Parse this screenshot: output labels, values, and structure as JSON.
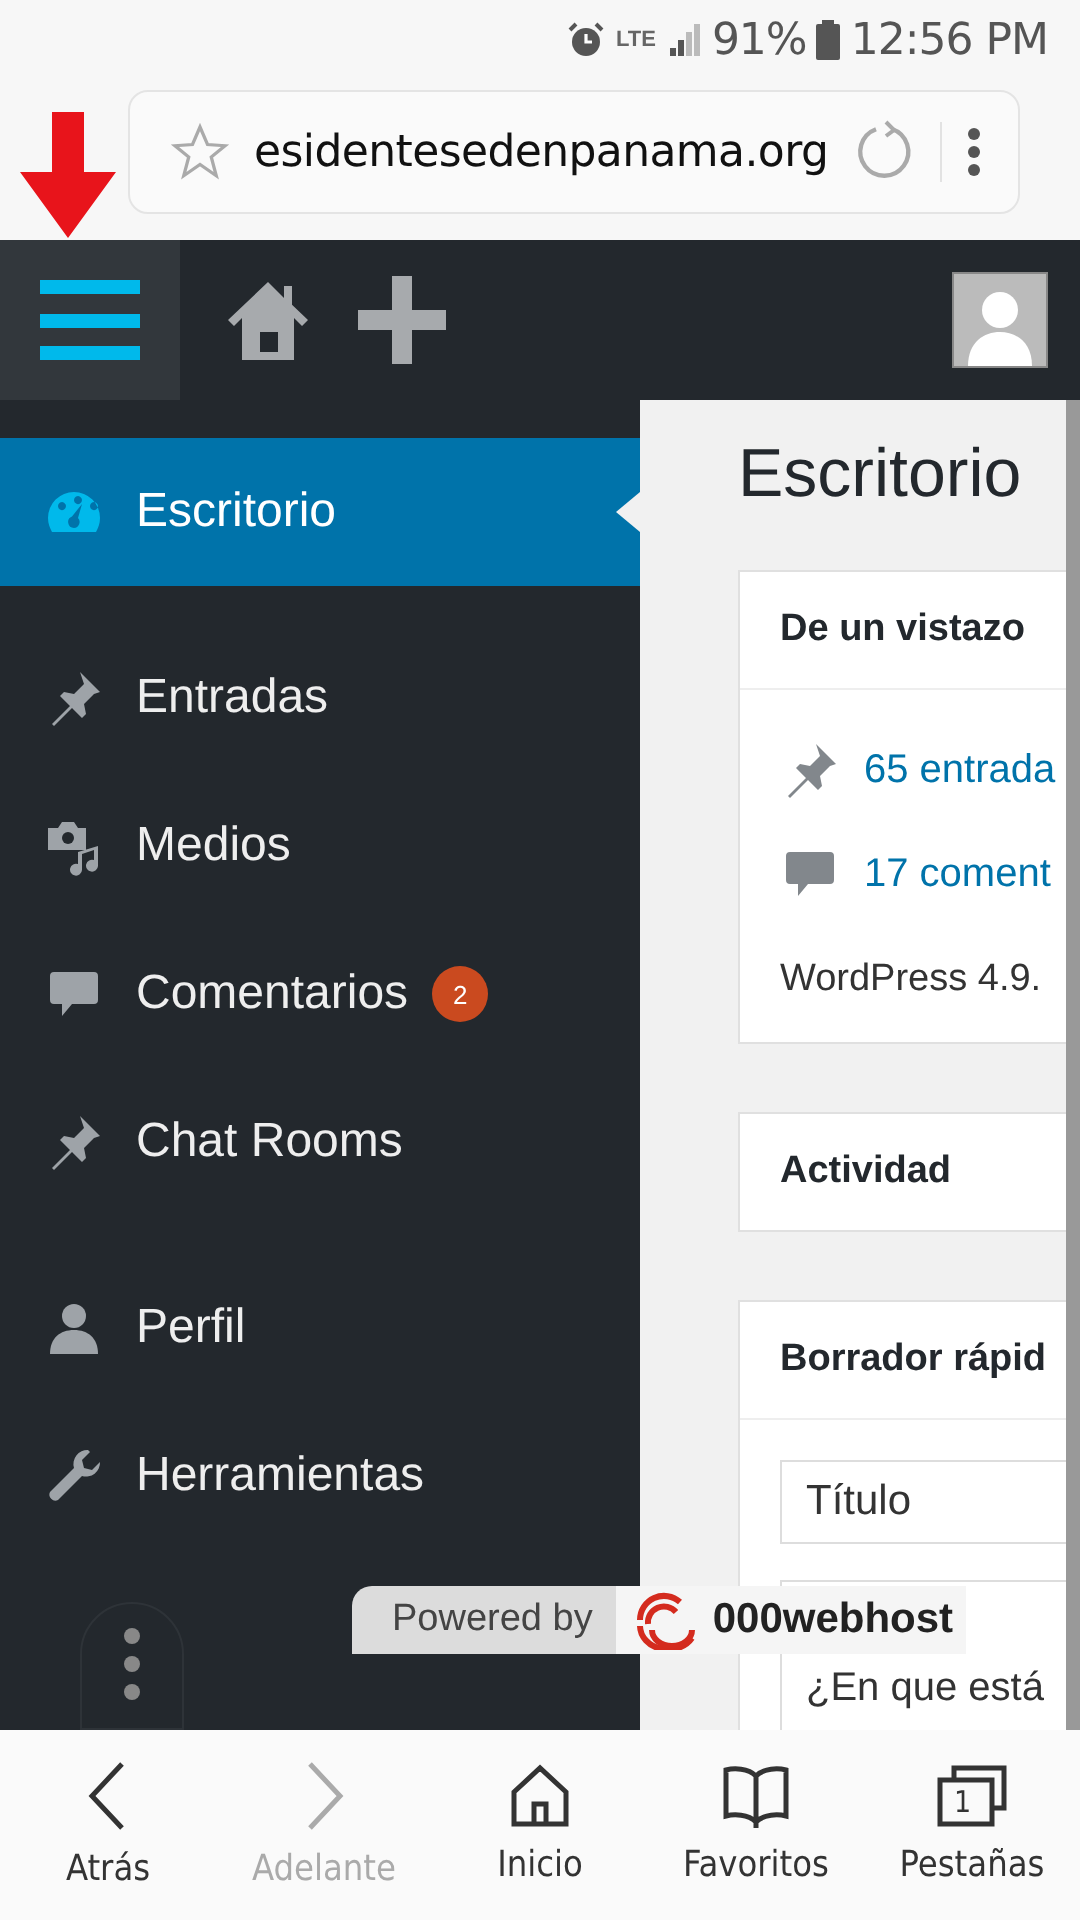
{
  "status_bar": {
    "network": "LTE",
    "battery": "91%",
    "time": "12:56 PM"
  },
  "address_bar": {
    "url": "esidentesedenpanama.org"
  },
  "admin_bar": {
    "menu_open": true
  },
  "sidebar": {
    "items": [
      {
        "label": "Escritorio",
        "selected": true
      },
      {
        "label": "Entradas",
        "selected": false
      },
      {
        "label": "Medios",
        "selected": false
      },
      {
        "label": "Comentarios",
        "selected": false,
        "badge": "2"
      },
      {
        "label": "Chat Rooms",
        "selected": false
      },
      {
        "label": "Perfil",
        "selected": false
      },
      {
        "label": "Herramientas",
        "selected": false
      }
    ]
  },
  "content": {
    "title": "Escritorio",
    "glance": {
      "heading": "De un vistazo",
      "links": [
        "65 entrada",
        "17 coment"
      ],
      "version": "WordPress 4.9."
    },
    "activity": {
      "heading": "Actividad"
    },
    "quick_draft": {
      "heading": "Borrador rápid",
      "title_placeholder": "Título",
      "body_placeholder": "¿En que está"
    }
  },
  "banner": {
    "text": "Powered by",
    "brand": "000webhost"
  },
  "bottom_nav": [
    {
      "label": "Atrás",
      "disabled": false
    },
    {
      "label": "Adelante",
      "disabled": true
    },
    {
      "label": "Inicio",
      "disabled": false
    },
    {
      "label": "Favoritos",
      "disabled": false
    },
    {
      "label": "Pestañas",
      "disabled": false,
      "count": "1"
    }
  ]
}
